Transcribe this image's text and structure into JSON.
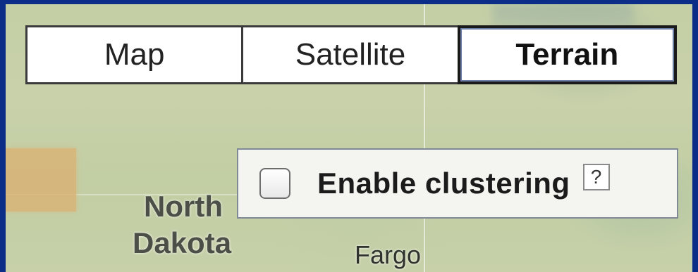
{
  "map_type_bar": {
    "buttons": [
      {
        "label": "Map",
        "active": false
      },
      {
        "label": "Satellite",
        "active": false
      },
      {
        "label": "Terrain",
        "active": true
      }
    ]
  },
  "cluster_panel": {
    "checkbox_checked": false,
    "label": "Enable clustering",
    "help_label": "?"
  },
  "map_labels": {
    "north": "North",
    "dakota": "Dakota",
    "fargo": "Fargo"
  },
  "colors": {
    "frame": "#0d2f8a",
    "map_base": "#c4cfa6",
    "region_highlight": "#d9b477"
  }
}
